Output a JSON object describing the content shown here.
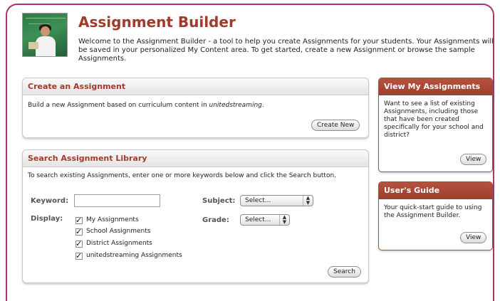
{
  "header": {
    "title": "Assignment Builder",
    "intro": "Welcome to the Assignment Builder - a tool to help you create Assignments for your students. Your Assignments will be saved in your personalized My Content area. To get started, create a new Assignment or browse the sample Assignments."
  },
  "create": {
    "title": "Create an Assignment",
    "desc_prefix": "Build a new Assignment based on curriculum content in ",
    "desc_brand": "unitedstreaming",
    "desc_suffix": ".",
    "button": "Create New"
  },
  "search": {
    "title": "Search Assignment Library",
    "instructions": "To search existing Assignments, enter one or more keywords below and click the Search button.",
    "keyword_label": "Keyword:",
    "keyword_value": "",
    "display_label": "Display:",
    "display_options": [
      {
        "label": "My Assignments",
        "checked": true
      },
      {
        "label": "School Assignments",
        "checked": true
      },
      {
        "label": "District Assignments",
        "checked": true
      },
      {
        "label": "unitedstreaming Assignments",
        "checked": true
      }
    ],
    "subject_label": "Subject:",
    "subject_value": "Select...",
    "grade_label": "Grade:",
    "grade_value": "Select...",
    "button": "Search"
  },
  "view_assignments": {
    "title": "View My Assignments",
    "text": "Want to see a list of existing Assignments, including those that have been created specifically for your school and district?",
    "button": "View"
  },
  "guide": {
    "title": "User's Guide",
    "text": "Your quick-start guide to using the Assignment Builder.",
    "button": "View"
  },
  "colors": {
    "accent": "#a23a2c",
    "frame": "#a8336f",
    "sidebar_header": "#a74b3a"
  },
  "icons": {
    "checkbox": "check-mark",
    "select_arrows": "up-down-arrows"
  }
}
